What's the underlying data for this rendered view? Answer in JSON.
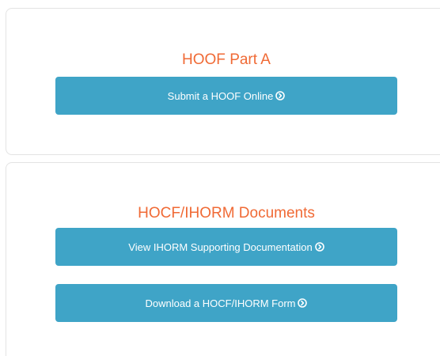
{
  "section_a": {
    "title": "HOOF Part A",
    "button_label": "Submit a HOOF Online"
  },
  "section_b": {
    "title": "HOCF/IHORM Documents",
    "buttons": [
      {
        "label": "View IHORM Supporting Documentation"
      },
      {
        "label": "Download a HOCF/IHORM Form"
      }
    ]
  },
  "colors": {
    "title": "#f06a35",
    "button_bg": "#3fa4c7",
    "button_text": "#ffffff",
    "card_border": "#e3e3e3"
  },
  "icons": {
    "button_arrow": "circle-chevron-right-icon"
  }
}
